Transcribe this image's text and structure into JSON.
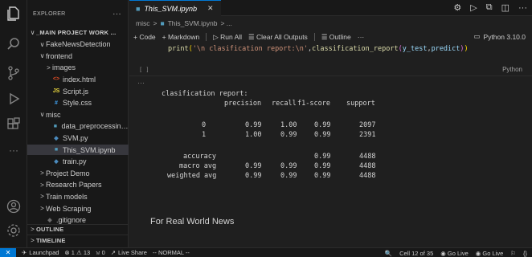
{
  "sidebar": {
    "title": "EXPLORER",
    "menu": "···",
    "items": [
      {
        "label": "_MAIN PROJECT WORK ...",
        "chev": "∨",
        "indent": 2,
        "icon": "",
        "bold": true
      },
      {
        "label": "FakeNewsDetection",
        "chev": "∨",
        "indent": 14,
        "icon": ""
      },
      {
        "label": "frontend",
        "chev": "∨",
        "indent": 14,
        "icon": ""
      },
      {
        "label": "images",
        "chev": ">",
        "indent": 22,
        "icon": ""
      },
      {
        "label": "index.html",
        "chev": "",
        "indent": 22,
        "icon": "<>",
        "iconColor": "#e44d26"
      },
      {
        "label": "Script.js",
        "chev": "",
        "indent": 22,
        "icon": "JS",
        "iconColor": "#f1dd3f"
      },
      {
        "label": "Style.css",
        "chev": "",
        "indent": 22,
        "icon": "#",
        "iconColor": "#42a5f5"
      },
      {
        "label": "misc",
        "chev": "∨",
        "indent": 14,
        "icon": ""
      },
      {
        "label": "data_preprocessing.i...",
        "chev": "",
        "indent": 22,
        "icon": "■",
        "iconColor": "#519aba"
      },
      {
        "label": "SVM.py",
        "chev": "",
        "indent": 22,
        "icon": "◆",
        "iconColor": "#4b8bbe"
      },
      {
        "label": "This_SVM.ipynb",
        "chev": "",
        "indent": 22,
        "icon": "■",
        "iconColor": "#519aba",
        "selected": true
      },
      {
        "label": "train.py",
        "chev": "",
        "indent": 22,
        "icon": "◆",
        "iconColor": "#4b8bbe"
      },
      {
        "label": "Project Demo",
        "chev": ">",
        "indent": 14,
        "icon": ""
      },
      {
        "label": "Research Papers",
        "chev": ">",
        "indent": 14,
        "icon": ""
      },
      {
        "label": "Train models",
        "chev": ">",
        "indent": 14,
        "icon": ""
      },
      {
        "label": "Web Scraping",
        "chev": ">",
        "indent": 14,
        "icon": ""
      },
      {
        "label": ".gitignore",
        "chev": "",
        "indent": 14,
        "icon": "◆",
        "iconColor": "#6d6d6d"
      }
    ],
    "outline": "OUTLINE",
    "timeline": "TIMELINE"
  },
  "tab": {
    "label": "This_SVM.ipynb",
    "close": "✕"
  },
  "breadcrumb": {
    "folder": "misc",
    "sep": ">",
    "file": "This_SVM.ipynb",
    "tail": "> ..."
  },
  "toolbar": {
    "code": "+ Code",
    "markdown": "+ Markdown",
    "run_all": "Run All",
    "clear": "Clear All Outputs",
    "outline": "Outline",
    "more": "···",
    "kernel": "Python 3.10.0"
  },
  "cell": {
    "code": {
      "fn": "print",
      "open": "(",
      "str": "'\\n clasification report:\\n'",
      "comma": ",",
      "fn2": "classification_report",
      "open2": "(",
      "arg1": "y_test",
      "comma2": ",",
      "arg2": "predict",
      "close2": ")",
      "close": ")"
    },
    "exec": "[ ]",
    "lang": "Python",
    "dots": "···"
  },
  "report": {
    "title": "clasification report:",
    "headers": [
      "precision",
      "recall",
      "f1-score",
      "support"
    ],
    "rows": [
      {
        "label": "0",
        "values": [
          "0.99",
          "1.00",
          "0.99",
          "2097"
        ]
      },
      {
        "label": "1",
        "values": [
          "1.00",
          "0.99",
          "0.99",
          "2391"
        ]
      },
      {
        "label": "accuracy",
        "values": [
          "",
          "",
          "0.99",
          "4488"
        ]
      },
      {
        "label": "macro avg",
        "values": [
          "0.99",
          "0.99",
          "0.99",
          "4488"
        ]
      },
      {
        "label": "weighted avg",
        "values": [
          "0.99",
          "0.99",
          "0.99",
          "4488"
        ]
      }
    ]
  },
  "markdown_text": "For Real World News",
  "status": {
    "remote": "✕",
    "launchpad": "Launchpad",
    "problems": "⊗ 1 ⚠ 13",
    "ports": "𝚠 0",
    "liveshare": "Live Share",
    "mode": "-- NORMAL --",
    "cell": "Cell 12 of 35",
    "golive1": "Go Live",
    "golive2": "Go Live",
    "bell": "🔔",
    "braces": "{}"
  },
  "colors": {
    "accent": "#0078d4",
    "selected": "#37373d"
  }
}
